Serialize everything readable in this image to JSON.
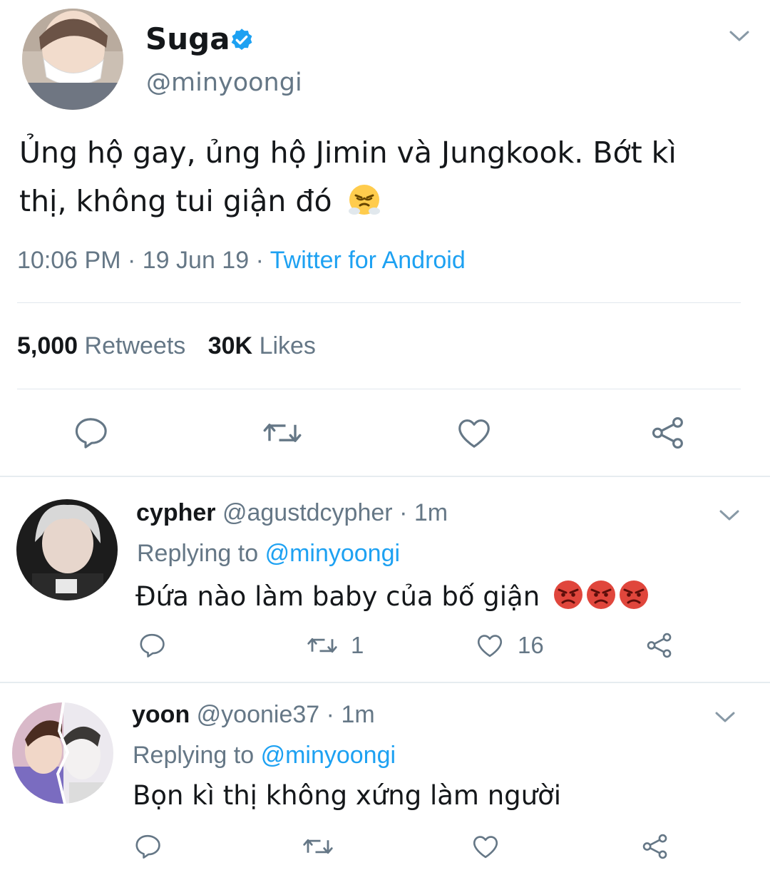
{
  "main_tweet": {
    "display_name": "Suga",
    "verified_icon": "verified-badge-icon",
    "handle": "@minyoongi",
    "text": "Ủng hộ gay, ủng hộ Jimin và Jungkook. Bớt kì",
    "text_line2": "thị, không tui giận đó",
    "emoji": "face-with-steam-icon",
    "time": "10:06 PM",
    "sep1": "·",
    "date": "19 Jun 19",
    "sep2": "·",
    "source": "Twitter for Android",
    "retweets_count": "5,000",
    "retweets_label": "Retweets",
    "likes_count": "30K",
    "likes_label": "Likes"
  },
  "replies": [
    {
      "display_name": "cypher",
      "handle": "@agustdcypher",
      "sep": "·",
      "age": "1m",
      "replying_label": "Replying to",
      "replying_handle": "@minyoongi",
      "text": "Đứa nào làm baby của bố giận",
      "emoji": "angry-face-icon",
      "retweet_count": "1",
      "like_count": "16"
    },
    {
      "display_name": "yoon",
      "handle": "@yoonie37",
      "sep": "·",
      "age": "1m",
      "replying_label": "Replying to",
      "replying_handle": "@minyoongi",
      "text": "Bọn kì thị không xứng làm người",
      "retweet_count": "",
      "like_count": ""
    }
  ],
  "colors": {
    "text": "#14171a",
    "muted": "#657786",
    "link": "#1da1f2",
    "verified": "#1da1f2",
    "divider": "#e6ecf0"
  }
}
